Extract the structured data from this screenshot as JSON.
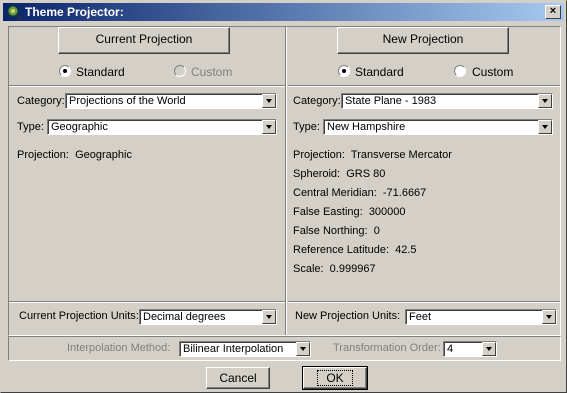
{
  "window": {
    "title": "Theme Projector:",
    "close_glyph": "×"
  },
  "current": {
    "tab_label": "Current Projection",
    "radio_standard": "Standard",
    "radio_custom": "Custom",
    "category_label": "Category:",
    "category_value": "Projections of the World",
    "type_label": "Type:",
    "type_value": "Geographic",
    "projection_line": "Projection:  Geographic",
    "units_label": "Current Projection Units:",
    "units_value": "Decimal degrees"
  },
  "new": {
    "tab_label": "New Projection",
    "radio_standard": "Standard",
    "radio_custom": "Custom",
    "category_label": "Category:",
    "category_value": "State Plane - 1983",
    "type_label": "Type:",
    "type_value": "New Hampshire",
    "params": [
      "Projection:  Transverse Mercator",
      "Spheroid:  GRS 80",
      "Central Meridian:  -71.6667",
      "False Easting:  300000",
      "False Northing:  0",
      "Reference Latitude:  42.5",
      "Scale:  0.999967"
    ],
    "units_label": "New Projection Units:",
    "units_value": "Feet"
  },
  "interpolation": {
    "label": "Interpolation Method:",
    "value": "Bilinear Interpolation",
    "order_label": "Transformation Order:",
    "order_value": "4"
  },
  "buttons": {
    "cancel": "Cancel",
    "ok": "OK"
  }
}
